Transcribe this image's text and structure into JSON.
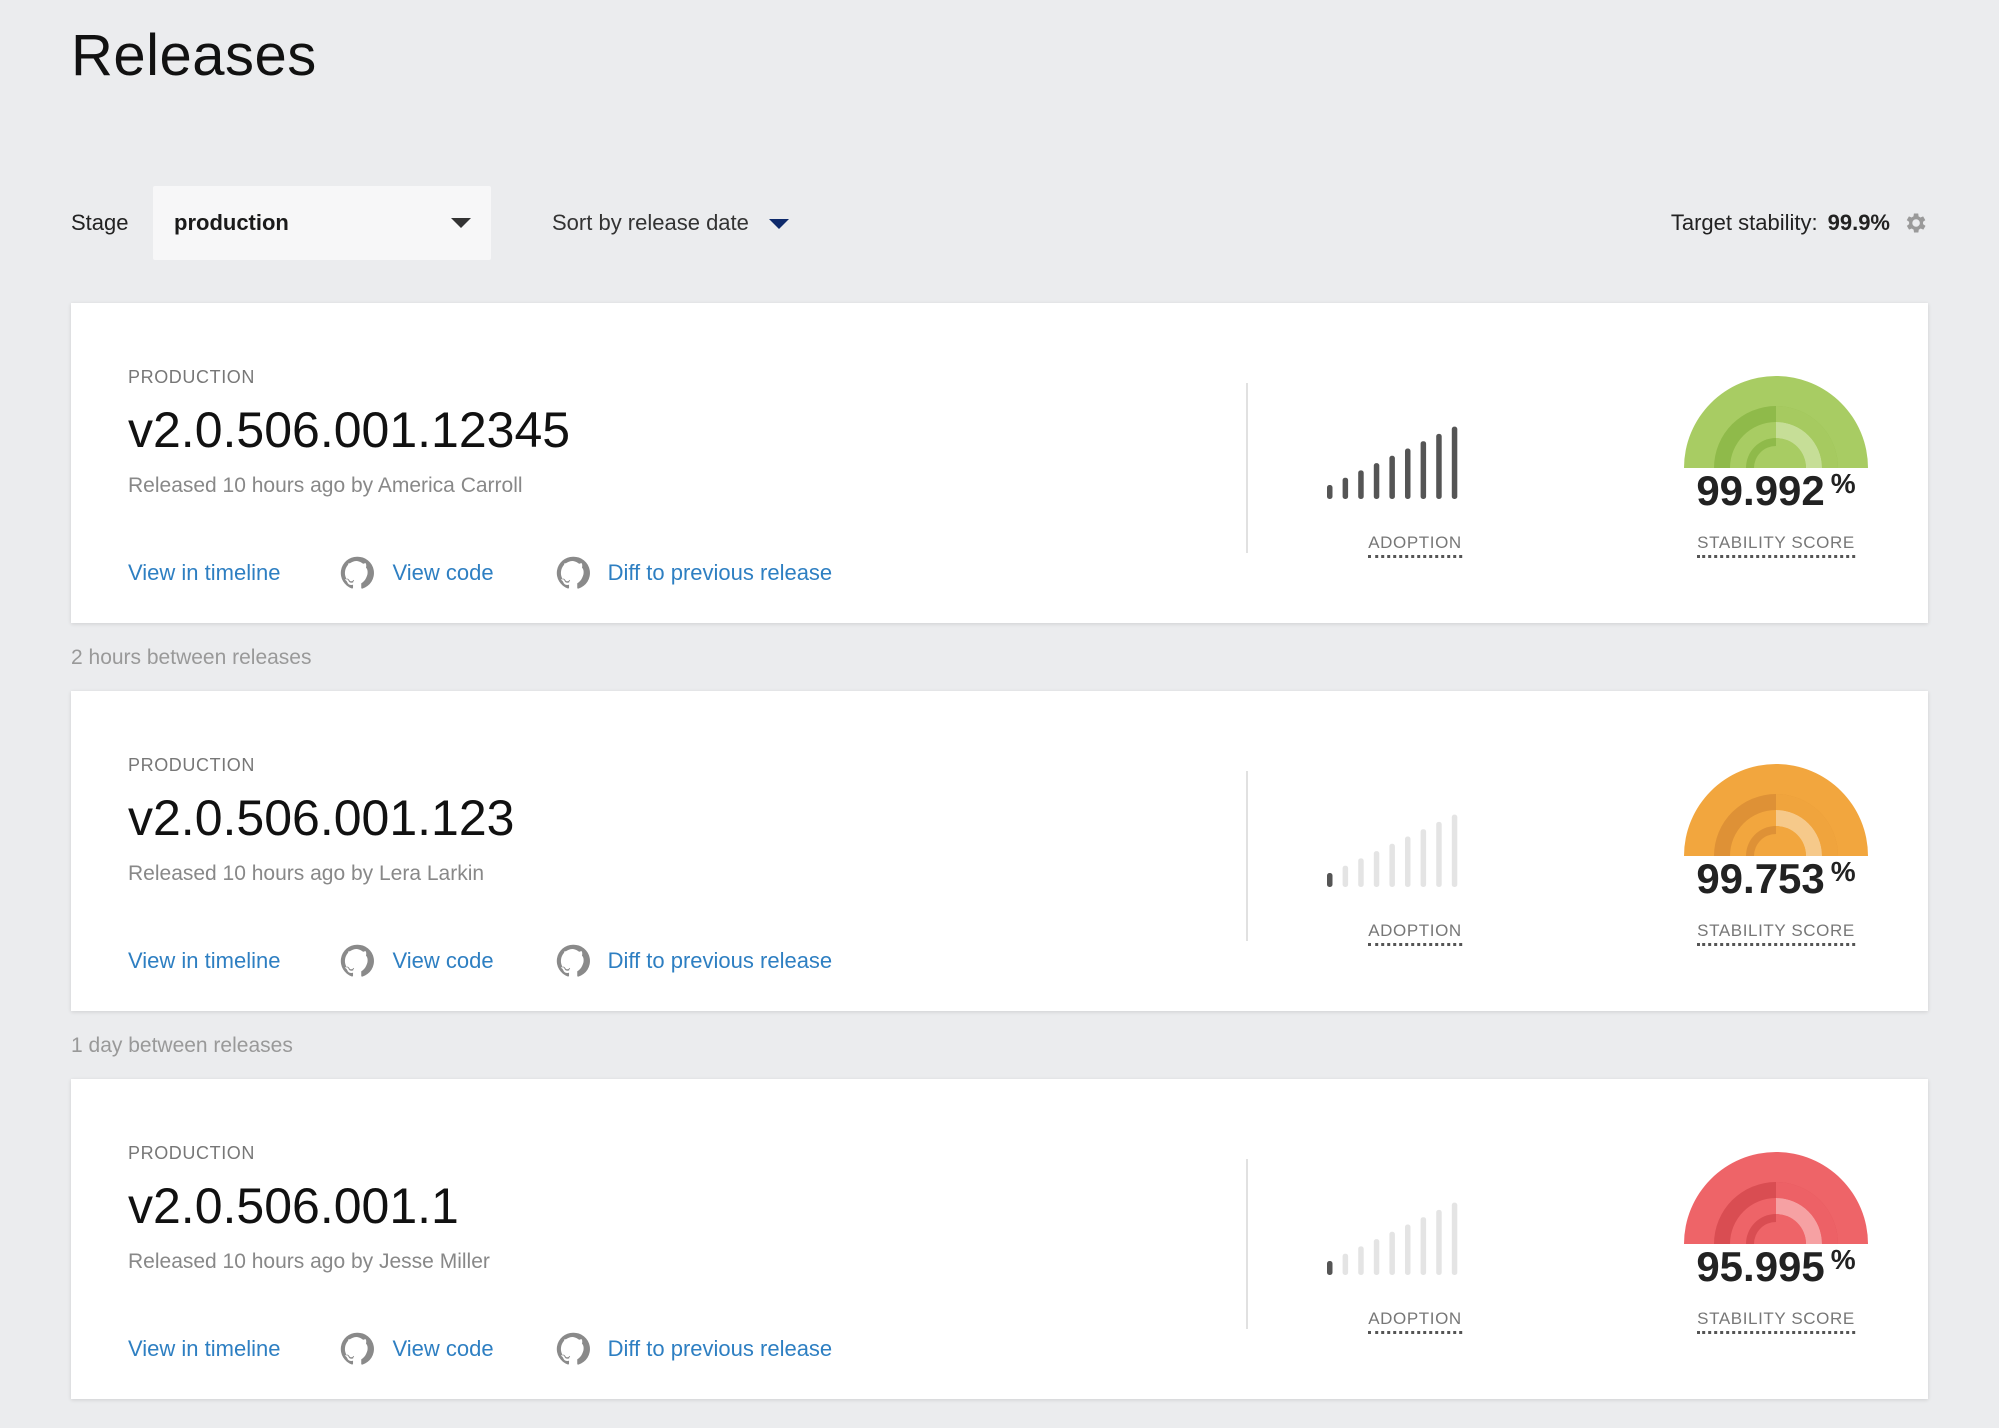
{
  "page": {
    "title": "Releases"
  },
  "filters": {
    "stage_label": "Stage",
    "stage_value": "production",
    "sort_label": "Sort by release date",
    "target_label": "Target stability:",
    "target_value": "99.9%"
  },
  "releases": [
    {
      "stage": "PRODUCTION",
      "version": "v2.0.506.001.12345",
      "released": "Released 10 hours ago by America Carroll",
      "links": {
        "timeline": "View in timeline",
        "code": "View code",
        "diff": "Diff to previous release"
      },
      "adoption_label": "ADOPTION",
      "adoption_level": 10,
      "adoption_max": 10,
      "stability_value": "99.992",
      "stability_unit": "%",
      "stability_label": "STABILITY SCORE",
      "gauge_color": "#a8cc63",
      "gauge_mid": "#8fba4a",
      "gauge_inner": "#c6de97"
    },
    {
      "stage": "PRODUCTION",
      "version": "v2.0.506.001.123",
      "released": "Released 10 hours ago by Lera Larkin",
      "links": {
        "timeline": "View in timeline",
        "code": "View code",
        "diff": "Diff to previous release"
      },
      "adoption_label": "ADOPTION",
      "adoption_level": 1,
      "adoption_max": 10,
      "stability_value": "99.753",
      "stability_unit": "%",
      "stability_label": "STABILITY SCORE",
      "gauge_color": "#f2a63e",
      "gauge_mid": "#de9136",
      "gauge_inner": "#f6c98a"
    },
    {
      "stage": "PRODUCTION",
      "version": "v2.0.506.001.1",
      "released": "Released 10 hours ago by Jesse Miller",
      "links": {
        "timeline": "View in timeline",
        "code": "View code",
        "diff": "Diff to previous release"
      },
      "adoption_label": "ADOPTION",
      "adoption_level": 1,
      "adoption_max": 10,
      "stability_value": "95.995",
      "stability_unit": "%",
      "stability_label": "STABILITY SCORE",
      "gauge_color": "#ee6468",
      "gauge_mid": "#d94d52",
      "gauge_inner": "#f6a1a3"
    }
  ],
  "between": [
    "2 hours between releases",
    "1 day between releases"
  ],
  "colors": {
    "background": "#ebecee",
    "link": "#2e7fc2",
    "adoption_active": "#555555",
    "adoption_inactive": "#e4e4e4"
  },
  "icons": {
    "select_caret": "chevron-down-icon",
    "settings": "gear-icon",
    "repo": "github-icon"
  }
}
